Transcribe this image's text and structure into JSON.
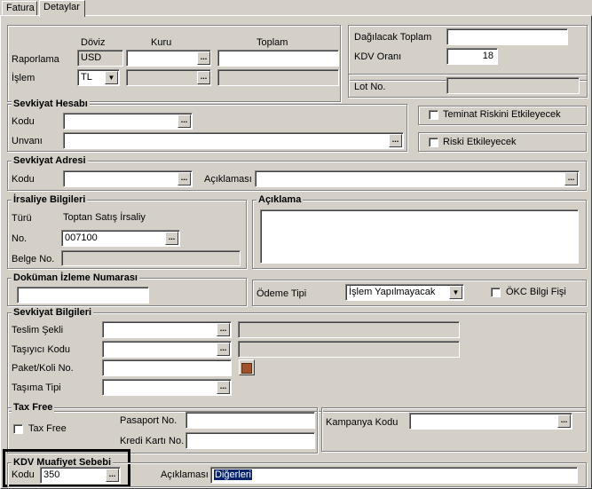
{
  "tabs": [
    {
      "label": "Fatura"
    },
    {
      "label": "Detaylar"
    }
  ],
  "currency": {
    "col_doviz": "Döviz",
    "col_kuru": "Kuru",
    "col_toplam": "Toplam",
    "raporlama_label": "Raporlama",
    "raporlama_doviz": "USD",
    "islem_label": "İşlem",
    "islem_doviz": "TL"
  },
  "summary": {
    "dagilacak_label": "Dağılacak Toplam",
    "kdv_orani_label": "KDV Oranı",
    "kdv_orani_value": "18",
    "lot_no_label": "Lot No."
  },
  "sevkiyat_hesabi": {
    "title": "Sevkiyat Hesabı",
    "kodu_label": "Kodu",
    "unvani_label": "Unvanı"
  },
  "checks": {
    "teminat": "Teminat Riskini Etkileyecek",
    "riski": "Riski Etkileyecek"
  },
  "sevkiyat_adresi": {
    "title": "Sevkiyat Adresi",
    "kodu_label": "Kodu",
    "aciklama_label": "Açıklaması"
  },
  "irsaliye": {
    "title": "İrsaliye Bilgileri",
    "turu_label": "Türü",
    "turu_value": "Toptan Satış İrsaliy",
    "no_label": "No.",
    "no_value": "007100",
    "belge_label": "Belge No."
  },
  "aciklama": {
    "title": "Açıklama"
  },
  "dokuman": {
    "title": "Doküman İzleme Numarası"
  },
  "odeme": {
    "label": "Ödeme Tipi",
    "value": "İşlem Yapılmayacak",
    "okc_label": "ÖKC Bilgi Fişi"
  },
  "sevkiyat_bilgileri": {
    "title": "Sevkiyat Bilgileri",
    "teslim_label": "Teslim Şekli",
    "tasiyici_label": "Taşıyıcı Kodu",
    "paket_label": "Paket/Koli No.",
    "tasima_label": "Taşıma Tipi"
  },
  "tax_free": {
    "title": "Tax Free",
    "check_label": "Tax Free",
    "pasaport_label": "Pasaport No.",
    "kredi_label": "Kredi Kartı No."
  },
  "kampanya": {
    "label": "Kampanya Kodu"
  },
  "kdv_muafiyet": {
    "title": "KDV Muafiyet Sebebi",
    "kodu_label": "Kodu",
    "kodu_value": "350",
    "aciklama_label": "Açıklaması",
    "aciklama_value": "Diğerleri"
  },
  "colors": {
    "highlight": "#0a246a",
    "panel": "#d4d0c8",
    "frame": "#000000"
  }
}
